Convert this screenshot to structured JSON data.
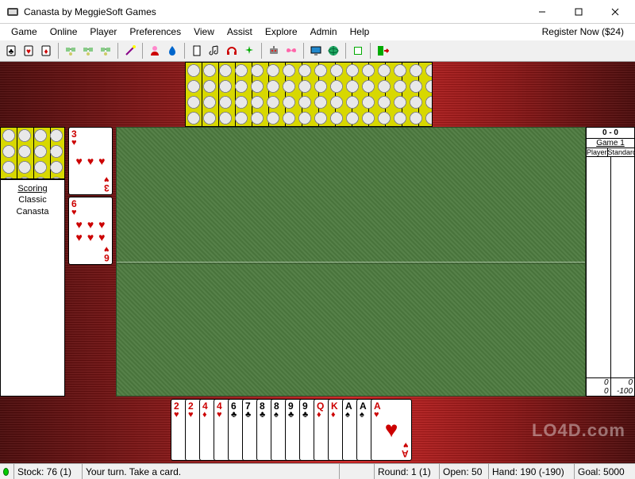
{
  "window": {
    "title": "Canasta by MeggieSoft Games"
  },
  "menu": {
    "items": [
      "Game",
      "Online",
      "Player",
      "Preferences",
      "View",
      "Assist",
      "Explore",
      "Admin",
      "Help"
    ],
    "register": "Register Now ($24)"
  },
  "toolbar": {
    "icons": [
      "card-black-icon",
      "card-red-icon",
      "card-red2-icon",
      "sep",
      "net-icon",
      "net2-icon",
      "net3-icon",
      "sep",
      "wand-icon",
      "sep",
      "person-icon",
      "droplet-icon",
      "sep",
      "clipboard-icon",
      "note-icon",
      "headset-icon",
      "sparkle-icon",
      "sep",
      "robot-icon",
      "butterfly-icon",
      "sep",
      "monitor-icon",
      "globe-icon",
      "sep",
      "book-icon",
      "sep",
      "exit-icon"
    ]
  },
  "scoring": {
    "title": "Scoring",
    "line1": "Classic",
    "line2": "Canasta"
  },
  "right_panel": {
    "score": "0 - 0",
    "game_label": "Game  1",
    "col1": "Player",
    "col2": "Standard",
    "foot1a": "0",
    "foot1b": "0",
    "foot2a": "0",
    "foot2b": "-100"
  },
  "discard": [
    {
      "rank": "3",
      "suit": "♥",
      "color": "red",
      "pips": 3
    },
    {
      "rank": "6",
      "suit": "♥",
      "color": "red",
      "pips": 6
    }
  ],
  "hand": [
    {
      "rank": "2",
      "suit": "♥",
      "color": "red"
    },
    {
      "rank": "2",
      "suit": "♥",
      "color": "red"
    },
    {
      "rank": "4",
      "suit": "♦",
      "color": "red"
    },
    {
      "rank": "4",
      "suit": "♥",
      "color": "red"
    },
    {
      "rank": "6",
      "suit": "♣",
      "color": "black"
    },
    {
      "rank": "7",
      "suit": "♣",
      "color": "black"
    },
    {
      "rank": "8",
      "suit": "♣",
      "color": "black"
    },
    {
      "rank": "8",
      "suit": "♠",
      "color": "black"
    },
    {
      "rank": "9",
      "suit": "♣",
      "color": "black"
    },
    {
      "rank": "9",
      "suit": "♣",
      "color": "black"
    },
    {
      "rank": "Q",
      "suit": "♦",
      "color": "red"
    },
    {
      "rank": "K",
      "suit": "♦",
      "color": "red"
    },
    {
      "rank": "A",
      "suit": "♠",
      "color": "black"
    },
    {
      "rank": "A",
      "suit": "♠",
      "color": "black"
    },
    {
      "rank": "A",
      "suit": "♥",
      "color": "red"
    }
  ],
  "status": {
    "stock": "Stock: 76 (1)",
    "turn": "Your turn.  Take a card.",
    "round": "Round: 1 (1)",
    "open": "Open: 50",
    "hand": "Hand: 190 (-190)",
    "goal": "Goal:  5000"
  },
  "watermark": "LO4D.com"
}
